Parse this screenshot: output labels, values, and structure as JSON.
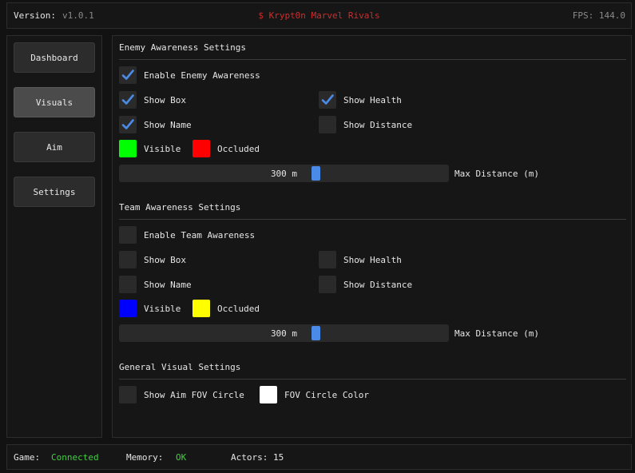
{
  "header": {
    "version_label": "Version:",
    "version_value": "v1.0.1",
    "title": "$ Krypt0n Marvel Rivals",
    "fps": "FPS: 144.0"
  },
  "sidebar": {
    "items": [
      {
        "label": "Dashboard",
        "active": false
      },
      {
        "label": "Visuals",
        "active": true
      },
      {
        "label": "Aim",
        "active": false
      },
      {
        "label": "Settings",
        "active": false
      }
    ]
  },
  "enemy": {
    "title": "Enemy Awareness Settings",
    "enable": {
      "label": "Enable Enemy Awareness",
      "checked": true
    },
    "show_box": {
      "label": "Show Box",
      "checked": true
    },
    "show_health": {
      "label": "Show Health",
      "checked": true
    },
    "show_name": {
      "label": "Show Name",
      "checked": true
    },
    "show_distance": {
      "label": "Show Distance",
      "checked": false
    },
    "visible": {
      "label": "Visible",
      "color": "#00ff00"
    },
    "occluded": {
      "label": "Occluded",
      "color": "#ff0000"
    },
    "slider": {
      "value_text": "300 m",
      "label": "Max Distance (m)"
    }
  },
  "team": {
    "title": "Team Awareness Settings",
    "enable": {
      "label": "Enable Team Awareness",
      "checked": false
    },
    "show_box": {
      "label": "Show Box",
      "checked": false
    },
    "show_health": {
      "label": "Show Health",
      "checked": false
    },
    "show_name": {
      "label": "Show Name",
      "checked": false
    },
    "show_distance": {
      "label": "Show Distance",
      "checked": false
    },
    "visible": {
      "label": "Visible",
      "color": "#0000ff"
    },
    "occluded": {
      "label": "Occluded",
      "color": "#ffff00"
    },
    "slider": {
      "value_text": "300 m",
      "label": "Max Distance (m)"
    }
  },
  "general": {
    "title": "General Visual Settings",
    "fov_circle": {
      "label": "Show Aim FOV Circle",
      "checked": false
    },
    "fov_color": {
      "label": "FOV Circle Color",
      "color": "#ffffff"
    }
  },
  "status": {
    "game_label": "Game:",
    "game_value": "Connected",
    "memory_label": "Memory:",
    "memory_value": "OK",
    "actors": "Actors: 15"
  },
  "colors": {
    "accent": "#4a8be8",
    "ok": "#3fcf3f",
    "title_red": "#d22b2b"
  }
}
